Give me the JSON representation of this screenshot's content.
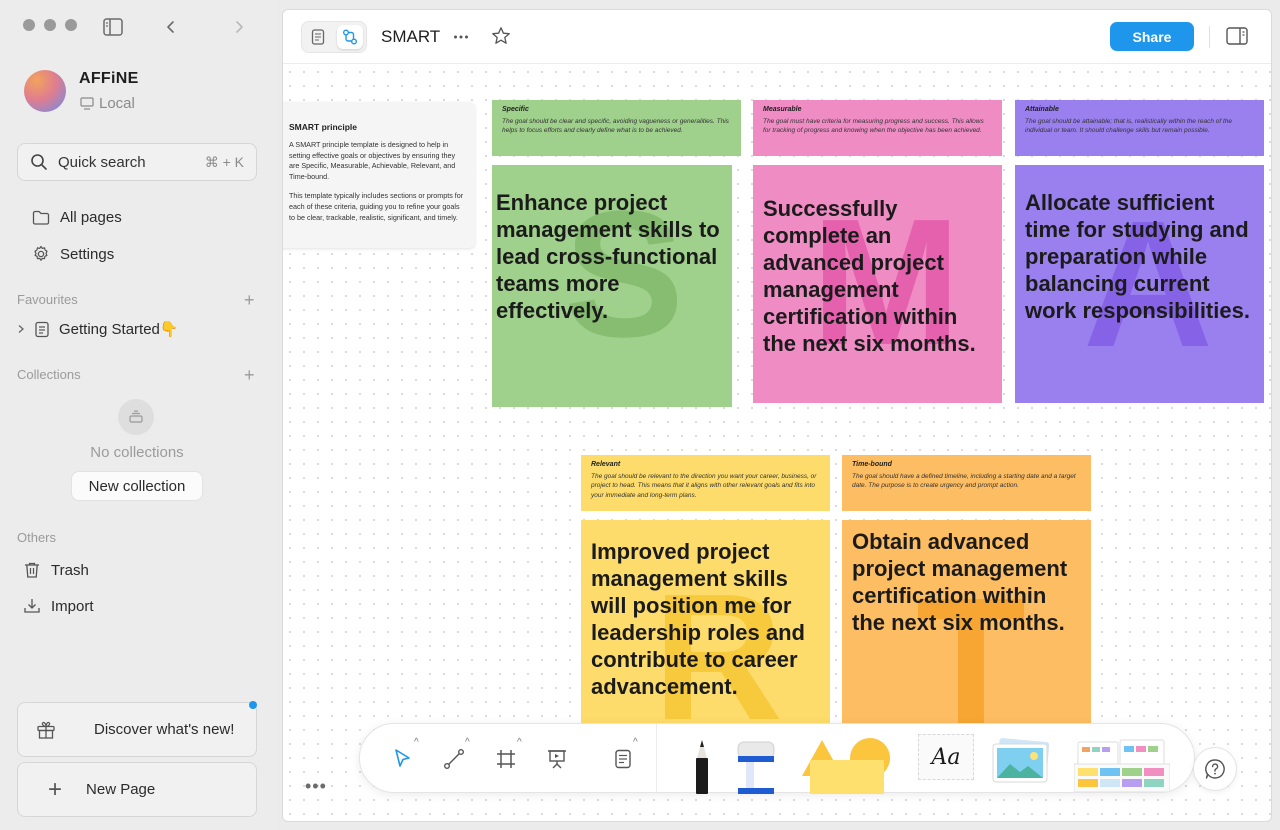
{
  "sidebar": {
    "workspace": {
      "name": "AFFiNE",
      "type": "Local"
    },
    "search": {
      "label": "Quick search",
      "shortcut": "⌘ + K"
    },
    "nav": [
      {
        "label": "All pages"
      },
      {
        "label": "Settings"
      }
    ],
    "favourites": {
      "label": "Favourites",
      "items": [
        {
          "label": "Getting Started👇"
        }
      ]
    },
    "collections": {
      "label": "Collections",
      "empty": "No collections",
      "new_label": "New collection"
    },
    "others": {
      "label": "Others",
      "items": [
        {
          "label": "Trash"
        },
        {
          "label": "Import"
        }
      ]
    },
    "discover_label": "Discover what's new!",
    "new_page_label": "New Page"
  },
  "header": {
    "title": "SMART",
    "share_label": "Share"
  },
  "canvas": {
    "intro": {
      "title": "SMART principle",
      "body1": "A SMART principle template is designed to help in setting effective goals or objectives by ensuring they are Specific, Measurable, Achievable, Relevant, and Time-bound.",
      "body2": "This template typically includes sections or prompts for each of these criteria, guiding you to refine your goals to be clear, trackable, realistic, significant, and timely."
    },
    "criteria": [
      {
        "title": "Specific",
        "desc": "The goal should be clear and specific, avoiding vagueness or generalities. This helps to focus efforts and clearly define what is to be achieved.",
        "letter": "S",
        "goal": "Enhance project management skills to lead cross-functional teams more effectively.",
        "color": "#9fd08c",
        "letter_color": "#86bd71"
      },
      {
        "title": "Measurable",
        "desc": "The goal must have criteria for measuring progress and success. This allows for tracking of progress and knowing when the objective has been achieved.",
        "letter": "M",
        "goal": "Successfully complete an advanced project management certification within the next six months.",
        "color": "#ef8cc4",
        "letter_color": "#e561ad"
      },
      {
        "title": "Attainable",
        "desc": "The goal should be attainable; that is, realistically within the reach of the individual or team. It should challenge skills but remain possible.",
        "letter": "A",
        "goal": "Allocate sufficient time for studying and preparation while balancing current work responsibilities.",
        "color": "#9a7fef",
        "letter_color": "#8662e6"
      },
      {
        "title": "Relevant",
        "desc": "The goal should be relevant to the direction you want your career, business, or project to head. This means that it aligns with other relevant goals and fits into your immediate and long-term plans.",
        "letter": "R",
        "goal": "Improved project management skills will position me for leadership roles and contribute to career advancement.",
        "color": "#fddc6b",
        "letter_color": "#f7c93c"
      },
      {
        "title": "Time-bound",
        "desc": "The goal should have a defined timeline, including a starting date and a target date. The purpose is to create urgency and prompt action.",
        "letter": "T",
        "goal": "Obtain advanced project management certification within the next six months.",
        "color": "#fdbd62",
        "letter_color": "#f7a634"
      }
    ]
  },
  "toolbar": {
    "text_tool_label": "Aa",
    "tools": [
      {
        "icon": "pointer-icon"
      },
      {
        "icon": "connector-icon"
      },
      {
        "icon": "frame-icon"
      },
      {
        "icon": "presentation-icon"
      },
      {
        "icon": "note-icon"
      }
    ]
  },
  "colors": {
    "accent": "#1e96eb",
    "canvas_dot": "#d9d9d9"
  }
}
